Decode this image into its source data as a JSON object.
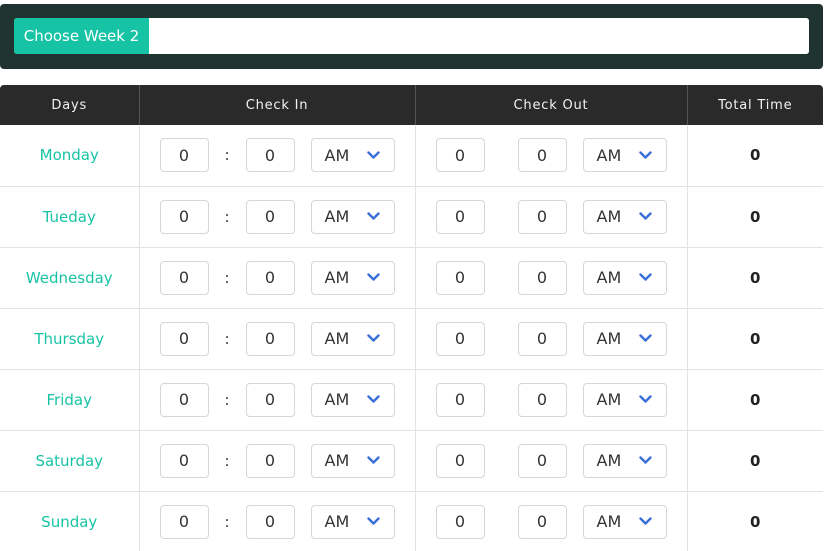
{
  "week_picker": {
    "button_label": "Choose Week 2",
    "input_value": ""
  },
  "table": {
    "headers": {
      "days": "Days",
      "check_in": "Check In",
      "check_out": "Check Out",
      "total_time": "Total Time"
    },
    "colon": ":",
    "rows": [
      {
        "day": "Monday",
        "in_hour": "0",
        "in_min": "0",
        "in_ampm": "AM",
        "out_hour": "0",
        "out_min": "0",
        "out_ampm": "AM",
        "total": "0"
      },
      {
        "day": "Tueday",
        "in_hour": "0",
        "in_min": "0",
        "in_ampm": "AM",
        "out_hour": "0",
        "out_min": "0",
        "out_ampm": "AM",
        "total": "0"
      },
      {
        "day": "Wednesday",
        "in_hour": "0",
        "in_min": "0",
        "in_ampm": "AM",
        "out_hour": "0",
        "out_min": "0",
        "out_ampm": "AM",
        "total": "0"
      },
      {
        "day": "Thursday",
        "in_hour": "0",
        "in_min": "0",
        "in_ampm": "AM",
        "out_hour": "0",
        "out_min": "0",
        "out_ampm": "AM",
        "total": "0"
      },
      {
        "day": "Friday",
        "in_hour": "0",
        "in_min": "0",
        "in_ampm": "AM",
        "out_hour": "0",
        "out_min": "0",
        "out_ampm": "AM",
        "total": "0"
      },
      {
        "day": "Saturday",
        "in_hour": "0",
        "in_min": "0",
        "in_ampm": "AM",
        "out_hour": "0",
        "out_min": "0",
        "out_ampm": "AM",
        "total": "0"
      },
      {
        "day": "Sunday",
        "in_hour": "0",
        "in_min": "0",
        "in_ampm": "AM",
        "out_hour": "0",
        "out_min": "0",
        "out_ampm": "AM",
        "total": "0"
      }
    ]
  },
  "icons": {
    "select_arrow": "chevron-down-icon"
  },
  "colors": {
    "accent": "#17c3a5",
    "topbar_bg": "#1f3330",
    "header_bg": "#2a2a2a",
    "chevron": "#3a6fd8"
  }
}
